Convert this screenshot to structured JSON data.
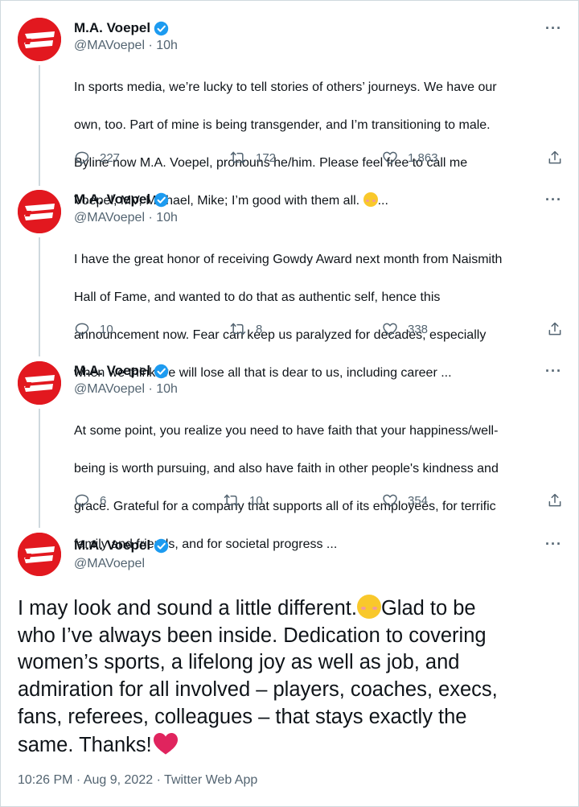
{
  "colors": {
    "brand": "#e2181f",
    "verified": "#1d9bf0",
    "text": "#0f1419",
    "muted": "#536471",
    "heart": "#e0245e"
  },
  "tweets": [
    {
      "name": "M.A. Voepel",
      "handle_time": "@MAVoepel · 10h",
      "more": "···",
      "lines": [
        "In sports media, we’re lucky to tell stories of others’ journeys. We have our",
        "own, too. Part of mine is being transgender, and I’m transitioning to male.",
        "Byline now M.A. Voepel, pronouns he/him. Please feel free to call me",
        "Voepel, MV, Michael, Mike; I’m good with them all."
      ],
      "ellipsis": "...",
      "replies": "227",
      "retweets": "172",
      "likes": "1,863"
    },
    {
      "name": "M.A. Voepel",
      "handle_time": "@MAVoepel · 10h",
      "more": "···",
      "lines": [
        "I have the great honor of receiving Gowdy Award next month from Naismith",
        "Hall of Fame, and wanted to do that as authentic self, hence this",
        "announcement now. Fear can keep us paralyzed for decades, especially",
        "when we think we will lose all that is dear to us, including career ..."
      ],
      "replies": "10",
      "retweets": "8",
      "likes": "338"
    },
    {
      "name": "M.A. Voepel",
      "handle_time": "@MAVoepel · 10h",
      "more": "···",
      "lines": [
        "At some point, you realize you need to have faith that your happiness/well-",
        "being is worth pursuing, and also have faith in other people's kindness and",
        "grace. Grateful for a company that supports all of its employees, for terrific",
        "family and friends, and for societal progress ..."
      ],
      "replies": "6",
      "retweets": "10",
      "likes": "354"
    }
  ],
  "main": {
    "name": "M.A. Voepel",
    "handle": "@MAVoepel",
    "more": "···",
    "line1_a": "I may look and sound a little different.",
    "line1_b": "Glad to be",
    "line2": "who I’ve always been inside. Dedication to covering",
    "line3": "women’s sports, a lifelong joy as well as job, and",
    "line4": "admiration for all involved – players, coaches, execs,",
    "line5": "fans, referees, colleagues – that stays exactly the",
    "line6": "same. Thanks!",
    "meta": "10:26 PM · Aug 9, 2022 · Twitter Web App"
  },
  "icons": {
    "avatar": "espn-logo-icon",
    "verified": "verified-badge-icon",
    "reply": "reply-icon",
    "retweet": "retweet-icon",
    "like": "heart-icon",
    "share": "share-icon",
    "more": "more-icon"
  }
}
